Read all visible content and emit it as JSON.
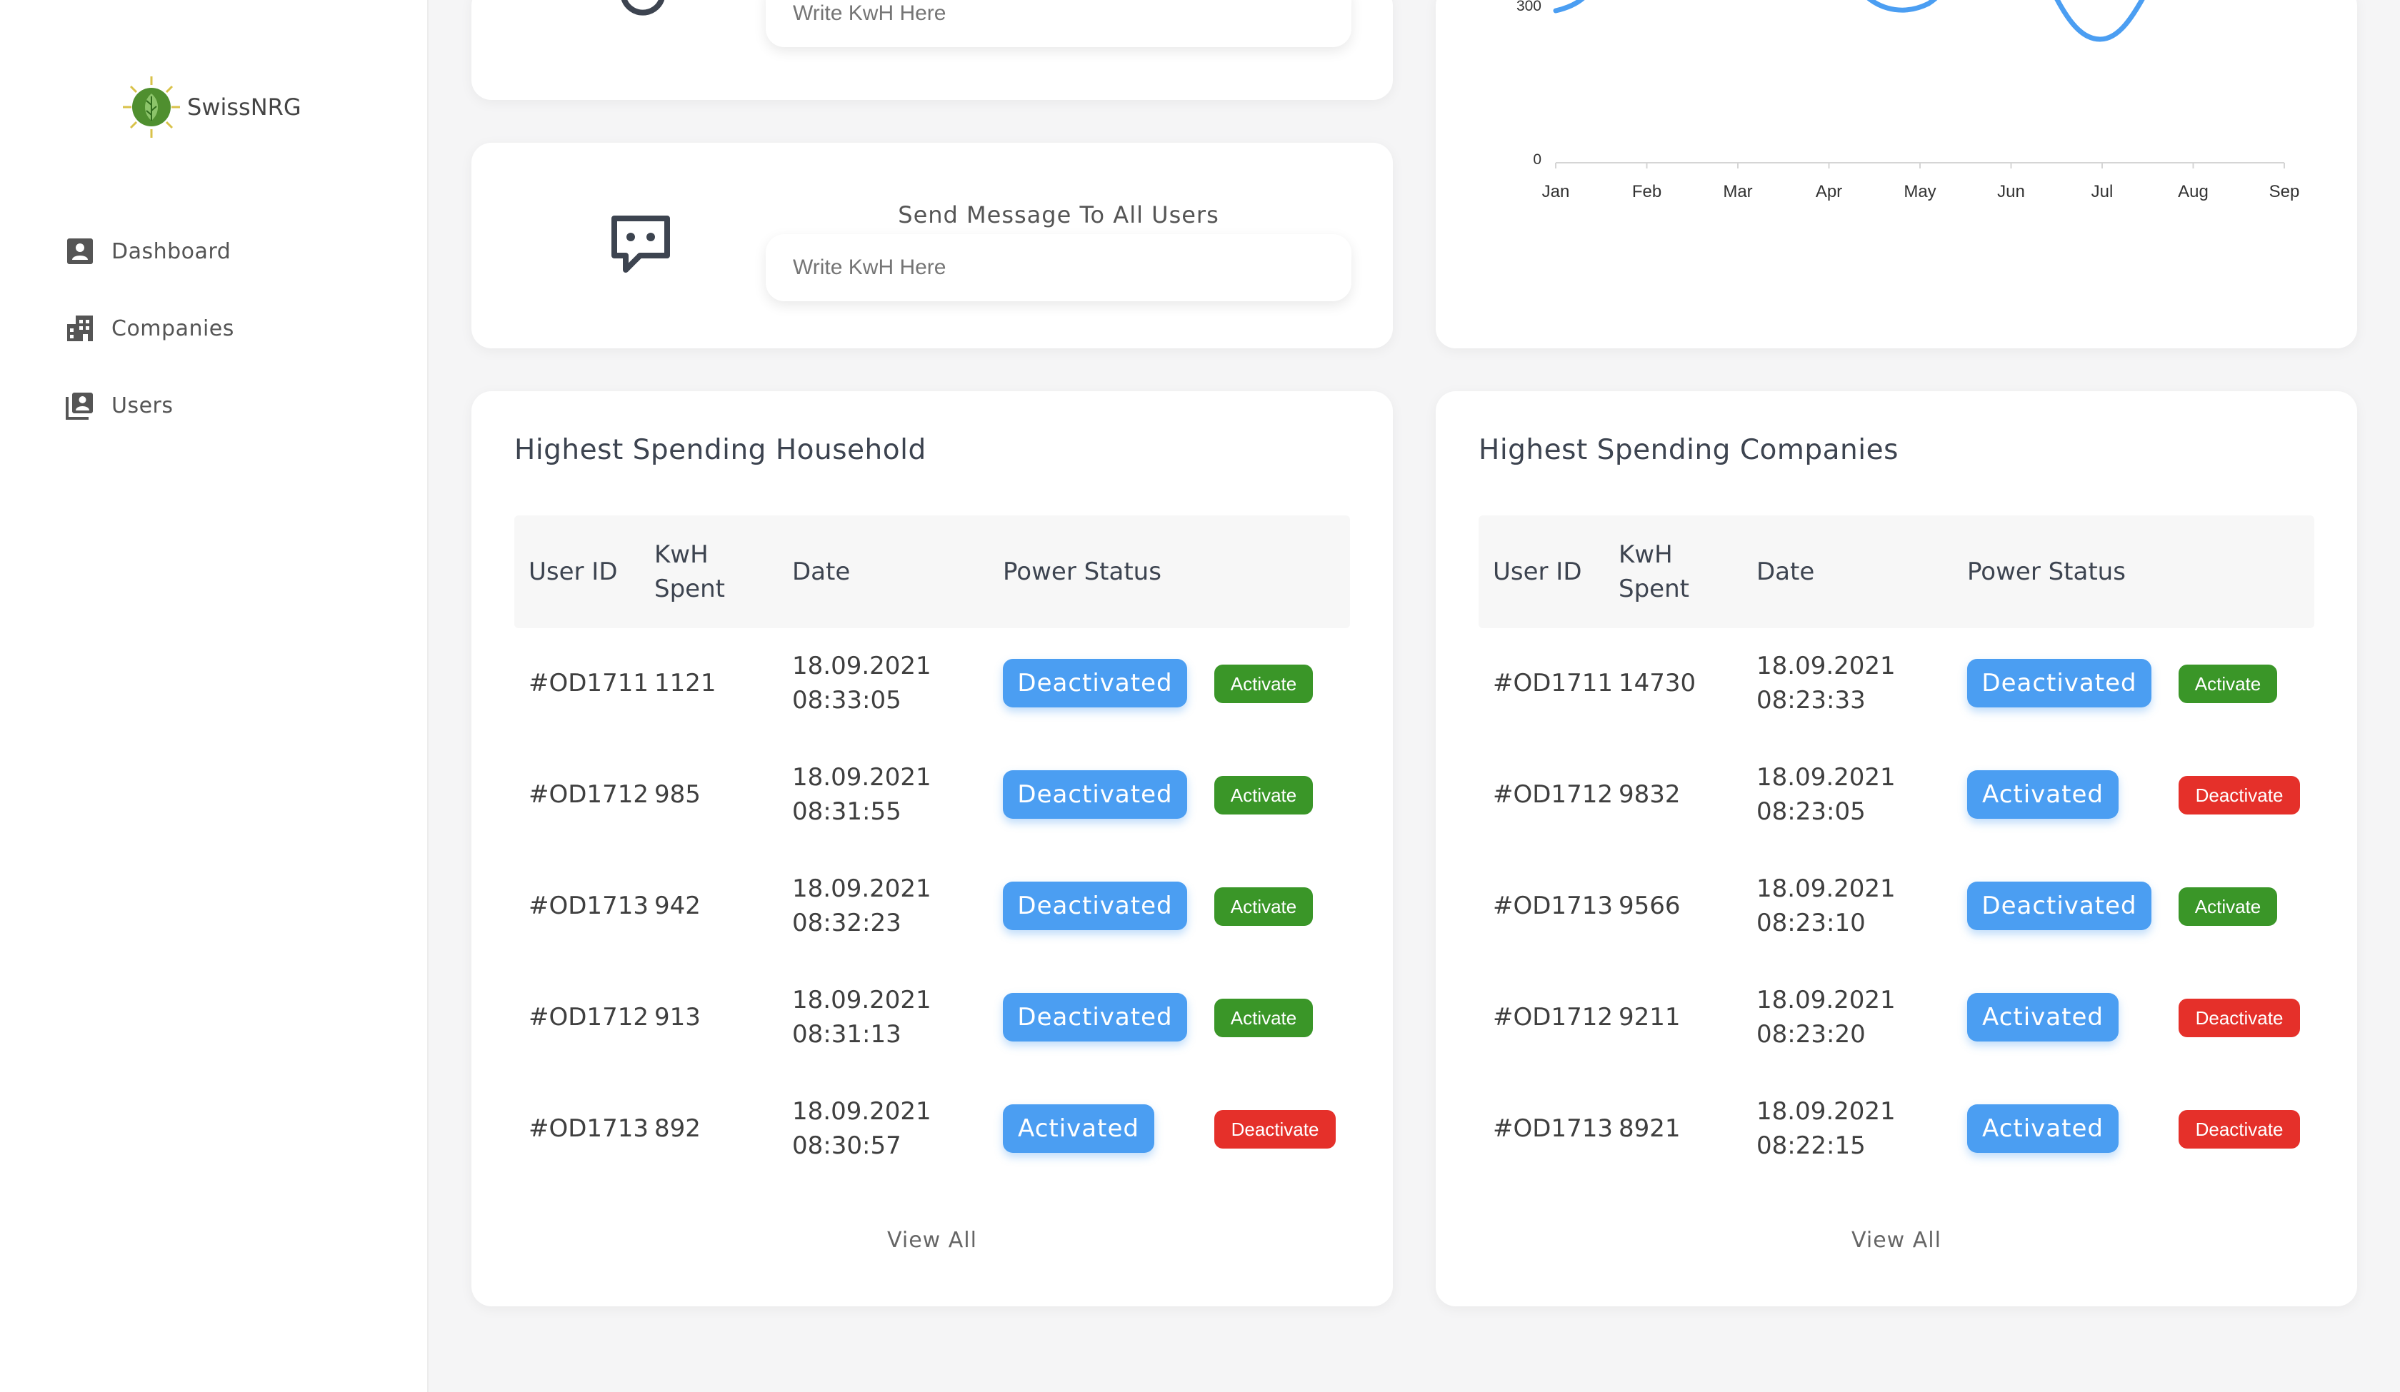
{
  "brand": {
    "name": "SwissNRG"
  },
  "sidebar": {
    "items": [
      {
        "label": "Dashboard",
        "icon": "person-card-icon"
      },
      {
        "label": "Companies",
        "icon": "building-icon"
      },
      {
        "label": "Users",
        "icon": "users-stack-icon"
      }
    ]
  },
  "kwh_input": {
    "placeholder": "Write KwH Here"
  },
  "message": {
    "title": "Send Message To All Users",
    "placeholder": "Write KwH Here"
  },
  "chart_data": {
    "type": "line",
    "categories": [
      "Jan",
      "Feb",
      "Mar",
      "Apr",
      "May",
      "Jun",
      "Jul",
      "Aug",
      "Sep"
    ],
    "yticks": [
      "300",
      "0"
    ],
    "line_color": "#4b9ef2",
    "partial": true
  },
  "household": {
    "title": "Highest Spending Household",
    "headers": {
      "user_id": "User ID",
      "kwh_1": "KwH",
      "kwh_2": "Spent",
      "date": "Date",
      "status": "Power Status"
    },
    "rows": [
      {
        "id": "#OD1711",
        "kwh": "1121",
        "date": "18.09.2021",
        "time": "08:33:05",
        "status": "Deactivated",
        "action": "Activate"
      },
      {
        "id": "#OD1712",
        "kwh": "985",
        "date": "18.09.2021",
        "time": "08:31:55",
        "status": "Deactivated",
        "action": "Activate"
      },
      {
        "id": "#OD1713",
        "kwh": "942",
        "date": "18.09.2021",
        "time": "08:32:23",
        "status": "Deactivated",
        "action": "Activate"
      },
      {
        "id": "#OD1712",
        "kwh": "913",
        "date": "18.09.2021",
        "time": "08:31:13",
        "status": "Deactivated",
        "action": "Activate"
      },
      {
        "id": "#OD1713",
        "kwh": "892",
        "date": "18.09.2021",
        "time": "08:30:57",
        "status": "Activated",
        "action": "Deactivate"
      }
    ],
    "view_all": "View All"
  },
  "companies": {
    "title": "Highest Spending Companies",
    "headers": {
      "user_id": "User ID",
      "kwh_1": "KwH",
      "kwh_2": "Spent",
      "date": "Date",
      "status": "Power Status"
    },
    "rows": [
      {
        "id": "#OD1711",
        "kwh": "14730",
        "date": "18.09.2021",
        "time": "08:23:33",
        "status": "Deactivated",
        "action": "Activate"
      },
      {
        "id": "#OD1712",
        "kwh": "9832",
        "date": "18.09.2021",
        "time": "08:23:05",
        "status": "Activated",
        "action": "Deactivate"
      },
      {
        "id": "#OD1713",
        "kwh": "9566",
        "date": "18.09.2021",
        "time": "08:23:10",
        "status": "Deactivated",
        "action": "Activate"
      },
      {
        "id": "#OD1712",
        "kwh": "9211",
        "date": "18.09.2021",
        "time": "08:23:20",
        "status": "Activated",
        "action": "Deactivate"
      },
      {
        "id": "#OD1713",
        "kwh": "8921",
        "date": "18.09.2021",
        "time": "08:22:15",
        "status": "Activated",
        "action": "Deactivate"
      }
    ],
    "view_all": "View All"
  },
  "colors": {
    "accent": "#4b9ef2",
    "activate": "#3a9628",
    "deactivate": "#e5302a",
    "logo_green": "#4f8f2f"
  }
}
